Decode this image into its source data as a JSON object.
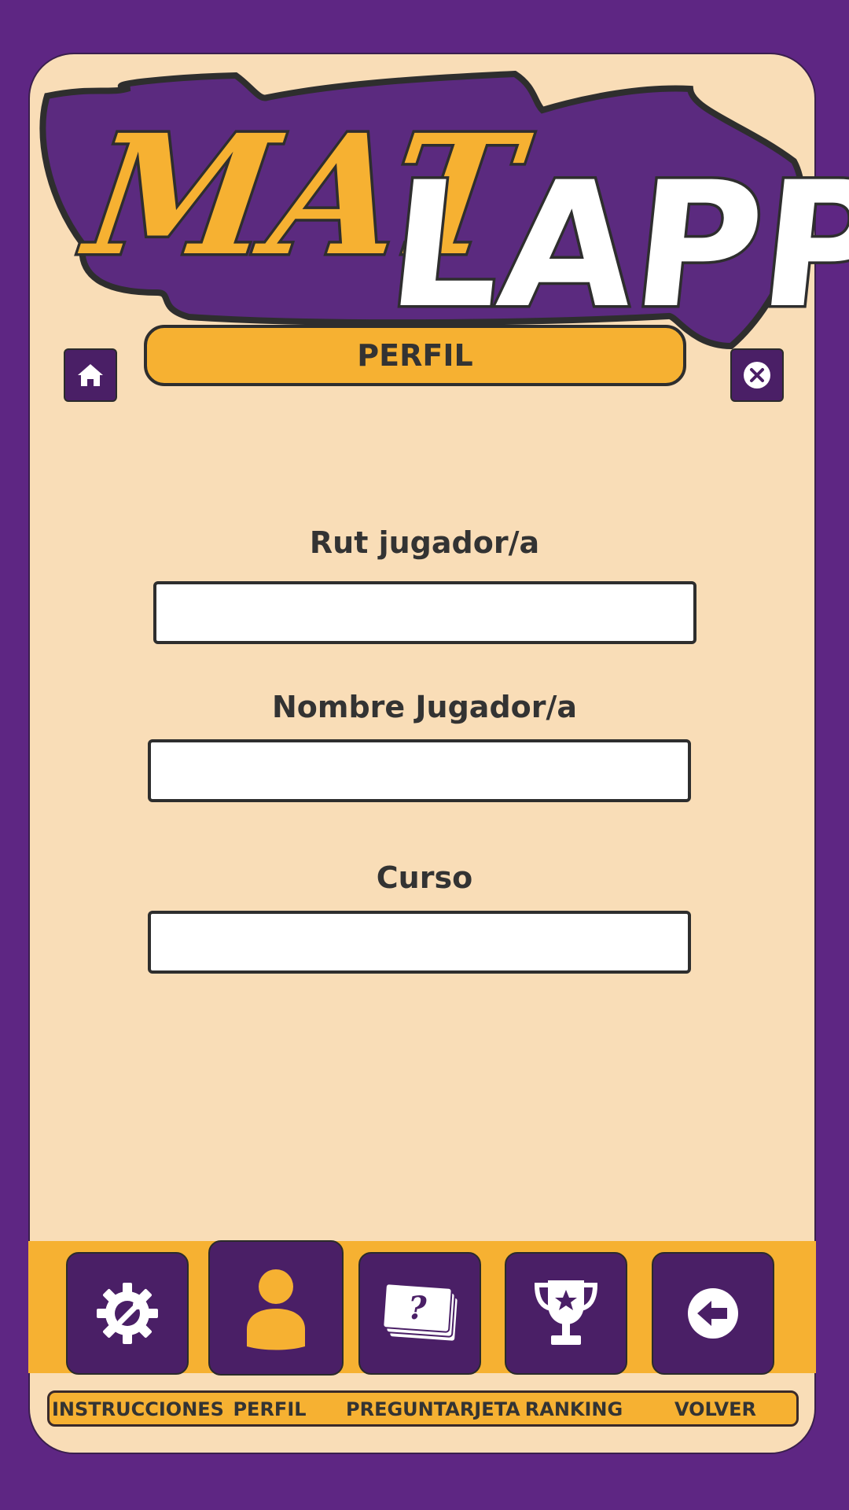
{
  "app": {
    "logo_left": "MAT",
    "logo_right": "LAPP"
  },
  "header": {
    "title": "PERFIL"
  },
  "form": {
    "rut_label": "Rut jugador/a",
    "rut_value": "",
    "nombre_label": "Nombre Jugador/a",
    "nombre_value": "",
    "curso_label": "Curso",
    "curso_value": ""
  },
  "nav": {
    "items": [
      {
        "label": "INSTRUCCIONES",
        "icon": "gear-wrench-icon"
      },
      {
        "label": "PERFIL",
        "icon": "user-icon"
      },
      {
        "label": "PREGUNTARJETA",
        "icon": "question-cards-icon"
      },
      {
        "label": "RANKING",
        "icon": "trophy-icon"
      },
      {
        "label": "VOLVER",
        "icon": "back-arrow-icon"
      }
    ]
  },
  "colors": {
    "background": "#5e2683",
    "panel": "#f9ddb7",
    "accent": "#f6b132",
    "button": "#4a1f66"
  }
}
